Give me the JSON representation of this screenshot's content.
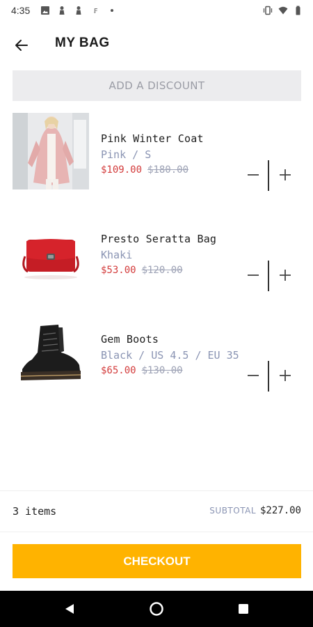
{
  "status_bar": {
    "time": "4:35",
    "left_icons": [
      "image-icon",
      "person-icon",
      "person-icon",
      "currency-icon",
      "dot-icon"
    ],
    "right_icons": [
      "vibrate-icon",
      "wifi-icon",
      "battery-icon"
    ]
  },
  "header": {
    "back_icon": "arrow-left-icon",
    "title": "MY BAG"
  },
  "discount": {
    "label": "ADD A DISCOUNT"
  },
  "items": [
    {
      "name": "Pink Winter Coat",
      "variant": "Pink / S",
      "price": "$109.00",
      "old_price": "$180.00",
      "image": "pink-coat-photo"
    },
    {
      "name": "Presto Seratta Bag",
      "variant": "Khaki",
      "price": "$53.00",
      "old_price": "$120.00",
      "image": "red-bag-photo"
    },
    {
      "name": "Gem Boots",
      "variant": "Black / US 4.5 / EU 35",
      "price": "$65.00",
      "old_price": "$130.00",
      "image": "black-boots-photo"
    }
  ],
  "summary": {
    "count": "3 items",
    "subtotal_label": "SUBTOTAL",
    "subtotal_value": "$227.00"
  },
  "checkout": {
    "label": "CHECKOUT"
  },
  "colors": {
    "accent": "#ffb300",
    "sale_price": "#d33c3c",
    "muted": "#8a94b3",
    "discount_bg": "#ececee"
  }
}
